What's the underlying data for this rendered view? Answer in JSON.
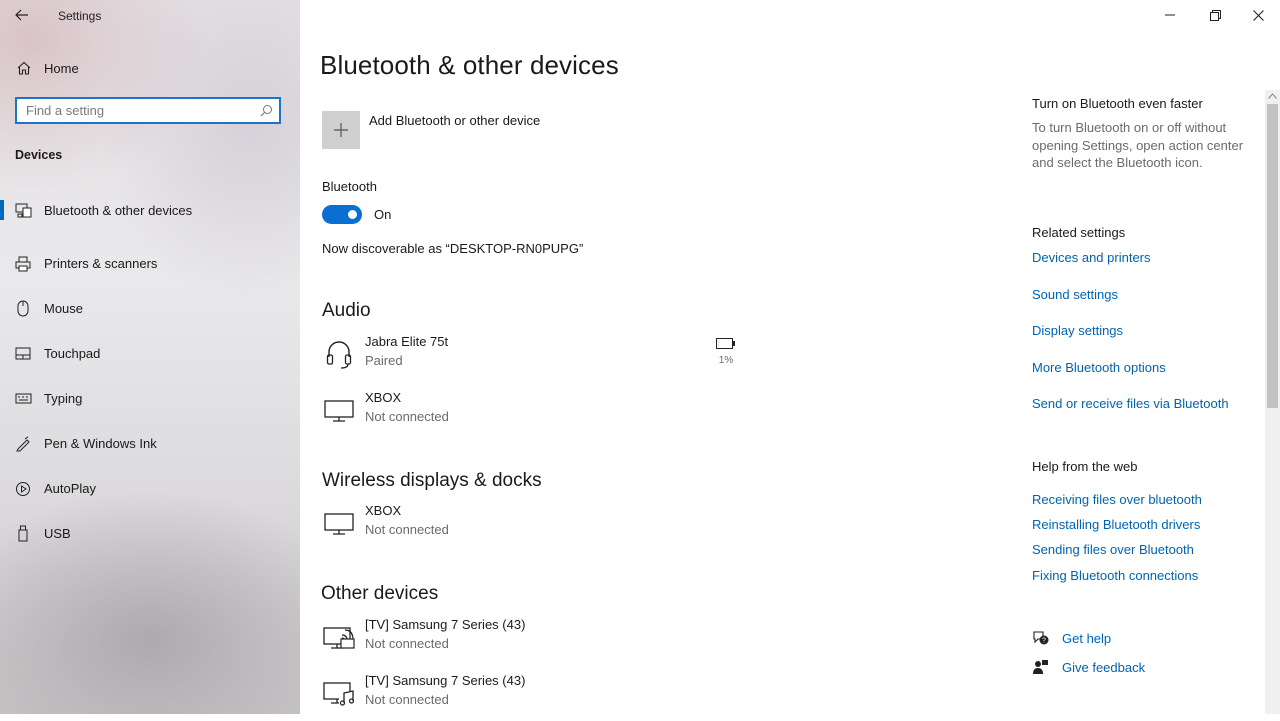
{
  "window": {
    "title": "Settings",
    "minimize_label": "Minimize",
    "restore_label": "Restore",
    "close_label": "Close"
  },
  "sidebar": {
    "home_label": "Home",
    "search_placeholder": "Find a setting",
    "section_title": "Devices",
    "items": [
      {
        "label": "Bluetooth & other devices",
        "icon": "bluetooth-devices-icon",
        "active": true
      },
      {
        "label": "Printers & scanners",
        "icon": "printer-icon"
      },
      {
        "label": "Mouse",
        "icon": "mouse-icon"
      },
      {
        "label": "Touchpad",
        "icon": "touchpad-icon"
      },
      {
        "label": "Typing",
        "icon": "keyboard-icon"
      },
      {
        "label": "Pen & Windows Ink",
        "icon": "pen-icon"
      },
      {
        "label": "AutoPlay",
        "icon": "autoplay-icon"
      },
      {
        "label": "USB",
        "icon": "usb-icon"
      }
    ]
  },
  "main": {
    "title": "Bluetooth & other devices",
    "add_device_label": "Add Bluetooth or other device",
    "bluetooth_label": "Bluetooth",
    "toggle_state": "On",
    "toggle_on": true,
    "discoverable_text": "Now discoverable as “DESKTOP-RN0PUPG”",
    "audio": {
      "heading": "Audio",
      "devices": [
        {
          "name": "Jabra Elite 75t",
          "status": "Paired",
          "icon": "headset-icon",
          "battery": "1%",
          "battery_level": 0.01
        },
        {
          "name": "XBOX",
          "status": "Not connected",
          "icon": "monitor-icon"
        }
      ]
    },
    "wireless": {
      "heading": "Wireless displays & docks",
      "devices": [
        {
          "name": "XBOX",
          "status": "Not connected",
          "icon": "monitor-icon"
        }
      ]
    },
    "other": {
      "heading": "Other devices",
      "devices": [
        {
          "name": "[TV] Samsung 7 Series (43)",
          "status": "Not connected",
          "icon": "tv-wireless-icon"
        },
        {
          "name": "[TV] Samsung 7 Series (43)",
          "status": "Not connected",
          "icon": "tv-media-icon"
        }
      ]
    }
  },
  "right": {
    "faster_heading": "Turn on Bluetooth even faster",
    "faster_text": "To turn Bluetooth on or off without opening Settings, open action center and select the Bluetooth icon.",
    "related_heading": "Related settings",
    "related_links": [
      "Devices and printers",
      "Sound settings",
      "Display settings",
      "More Bluetooth options",
      "Send or receive files via Bluetooth"
    ],
    "web_heading": "Help from the web",
    "web_links": [
      "Receiving files over bluetooth",
      "Reinstalling Bluetooth drivers",
      "Sending files over Bluetooth",
      "Fixing Bluetooth connections"
    ],
    "get_help": "Get help",
    "give_feedback": "Give feedback"
  },
  "colors": {
    "accent": "#0067c0",
    "link": "#0063b1",
    "toggle": "#0a6fd0"
  }
}
